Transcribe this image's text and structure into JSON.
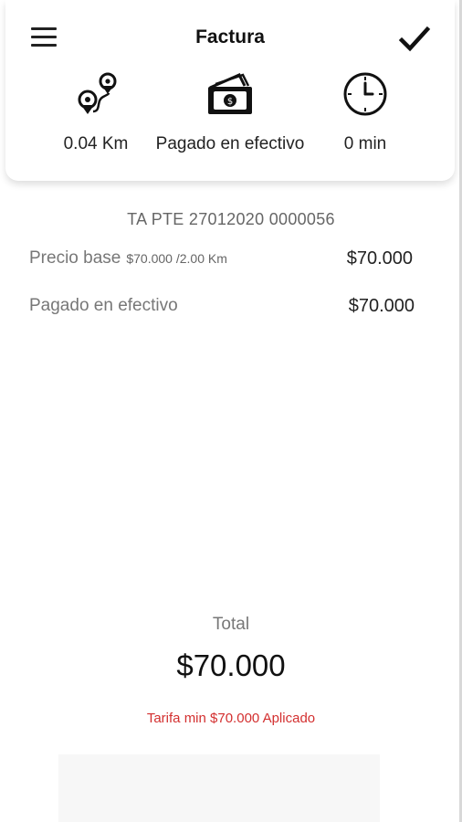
{
  "header": {
    "title": "Factura",
    "menu_icon": "hamburger-menu-icon",
    "confirm_icon": "checkmark-icon"
  },
  "stats": {
    "distance": {
      "icon": "route-pins-icon",
      "value": "0.04 Km"
    },
    "payment": {
      "icon": "cash-bills-icon",
      "value": "Pagado en efectivo"
    },
    "time": {
      "icon": "clock-icon",
      "value": "0 min"
    }
  },
  "invoice": {
    "reference": "TA PTE 27012020 0000056",
    "lines": [
      {
        "label": "Precio base",
        "detail": "$70.000 /2.00 Km",
        "amount": "$70.000"
      },
      {
        "label": "Pagado en efectivo",
        "detail": "",
        "amount": "$70.000"
      }
    ]
  },
  "total": {
    "label": "Total",
    "value": "$70.000",
    "note": "Tarifa min $70.000 Aplicado"
  },
  "colors": {
    "note_red": "#d32f2f",
    "text_dark": "#111111",
    "text_muted": "#777777"
  }
}
